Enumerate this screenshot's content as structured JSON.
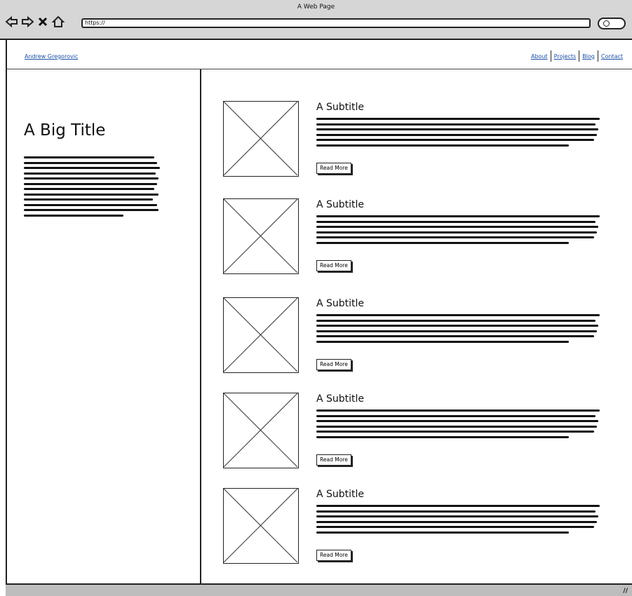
{
  "window": {
    "title": "A Web Page",
    "url": "https://"
  },
  "toolbar": {
    "icons": [
      "back-arrow-icon",
      "forward-arrow-icon",
      "close-x-icon",
      "home-icon",
      "search-icon"
    ]
  },
  "header": {
    "brand": "Andrew Gregorovic",
    "nav": [
      {
        "label": "About"
      },
      {
        "label": "Projects"
      },
      {
        "label": "Blog"
      },
      {
        "label": "Contact"
      }
    ]
  },
  "sidebar": {
    "title": "A Big Title"
  },
  "posts": [
    {
      "title": "A Subtitle",
      "button": "Read More"
    },
    {
      "title": "A Subtitle",
      "button": "Read More"
    },
    {
      "title": "A Subtitle",
      "button": "Read More"
    },
    {
      "title": "A Subtitle",
      "button": "Read More"
    },
    {
      "title": "A Subtitle",
      "button": "Read More"
    }
  ],
  "statusbar": {
    "grip": "//"
  }
}
